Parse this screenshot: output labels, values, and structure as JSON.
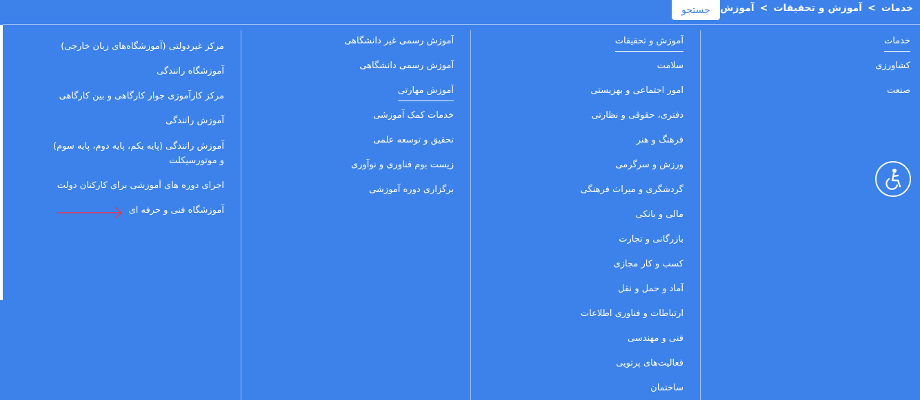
{
  "breadcrumb": {
    "items": [
      "خدمات",
      "آموزش و تحقیقات",
      "آموزش مهارتی"
    ],
    "separator": ">"
  },
  "search": {
    "label": "جستجو"
  },
  "columns": {
    "col1": {
      "items": [
        "خدمات",
        "کشاورزی",
        "صنعت"
      ]
    },
    "col2": {
      "items": [
        "آموزش و تحقیقات",
        "سلامت",
        "امور اجتماعی و بهزیستی",
        "دفتری، حقوقی و نظارتی",
        "فرهنگ و هنر",
        "ورزش و سرگرمی",
        "گردشگری و میراث فرهنگی",
        "مالی و بانکی",
        "بازرگانی و تجارت",
        "کسب و کار مجازی",
        "آماد و حمل و نقل",
        "ارتباطات و فناوری اطلاعات",
        "فنی و مهندسی",
        "فعالیت‌های پرتویی",
        "ساختمان"
      ]
    },
    "col3": {
      "items": [
        "آموزش رسمی غیر دانشگاهی",
        "آموزش رسمی دانشگاهی",
        "آموزش مهارتی",
        "خدمات کمک آموزشی",
        "تحقیق و توسعه علمی",
        "زیست بوم فناوری و نوآوری",
        "برگزاری دوره آموزشی"
      ]
    },
    "col4": {
      "items": [
        "مرکز غیردولتی (آموزشگاه‌های زبان خارجی)",
        "آموزشگاه رانندگی",
        "مرکز کارآموزی جوار کارگاهی و بین کارگاهی",
        "آموزش رانندگی",
        "آموزش رانندگی (پایه یکم، پایه دوم، پایه سوم) و موتورسیکلت",
        "اجرای دوره های آموزشی برای کارکنان دولت",
        "آموزشگاه فنی و حرفه ای"
      ]
    }
  },
  "colors": {
    "background": "#3c82ea",
    "text": "#ffffff",
    "arrow": "#e8344e"
  },
  "icons": {
    "accessibility": "wheelchair-icon",
    "annotation": "arrow-right-icon"
  }
}
